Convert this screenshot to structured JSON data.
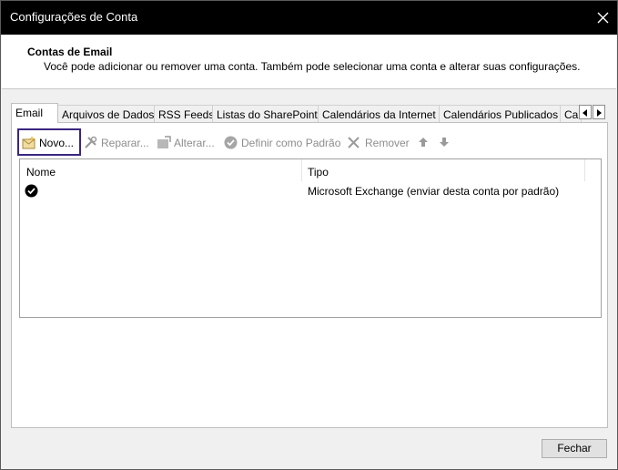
{
  "window": {
    "title": "Configurações de Conta"
  },
  "header": {
    "title": "Contas de Email",
    "description": "Você pode adicionar ou remover uma conta. Também pode selecionar uma conta e alterar suas configurações."
  },
  "tabs": [
    {
      "label": "Email",
      "active": true
    },
    {
      "label": "Arquivos de Dados"
    },
    {
      "label": "RSS Feeds"
    },
    {
      "label": "Listas do SharePoint"
    },
    {
      "label": "Calendários da Internet"
    },
    {
      "label": "Calendários Publicados"
    },
    {
      "label": "Ca"
    }
  ],
  "toolbar": {
    "new_label": "Novo...",
    "repair_label": "Reparar...",
    "change_label": "Alterar...",
    "default_label": "Definir como Padrão",
    "remove_label": "Remover"
  },
  "table": {
    "columns": [
      "Nome",
      "Tipo"
    ],
    "rows": [
      {
        "name": "",
        "type": "Microsoft Exchange (enviar desta conta por padrão)",
        "is_default": true
      }
    ]
  },
  "footer": {
    "close_label": "Fechar"
  },
  "colors": {
    "titlebar": "#000000",
    "highlight_border": "#3a2680"
  }
}
